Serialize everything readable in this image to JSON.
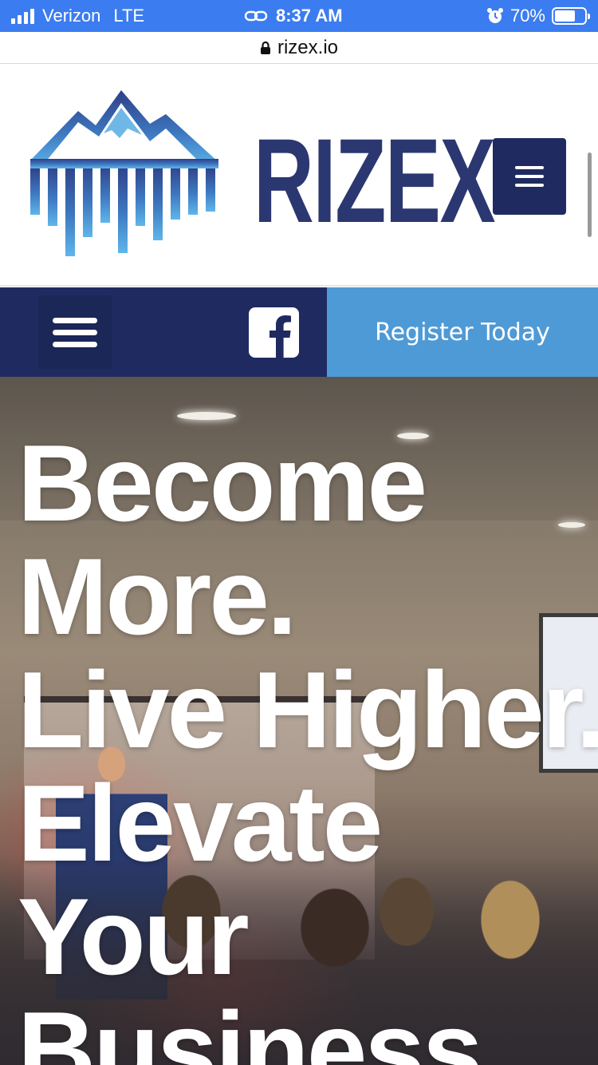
{
  "status_bar": {
    "carrier": "Verizon",
    "network": "LTE",
    "time": "8:37 AM",
    "battery": "70%",
    "battery_level": 0.7
  },
  "browser": {
    "url": "rizex.io"
  },
  "header": {
    "logo_text": "RIZEX",
    "menu_button_icon": "hamburger-icon"
  },
  "nav": {
    "menu_icon": "hamburger-icon",
    "social_icon": "facebook-icon",
    "register_label": "Register Today"
  },
  "hero": {
    "headline_lines": [
      "Become",
      "More.",
      "Live Higher.",
      "Elevate",
      "Your",
      "Business."
    ]
  },
  "colors": {
    "status_bar": "#3b7cf0",
    "brand_navy": "#1f2b60",
    "register_blue": "#4e9ad6",
    "logo_text": "#2b3770"
  }
}
